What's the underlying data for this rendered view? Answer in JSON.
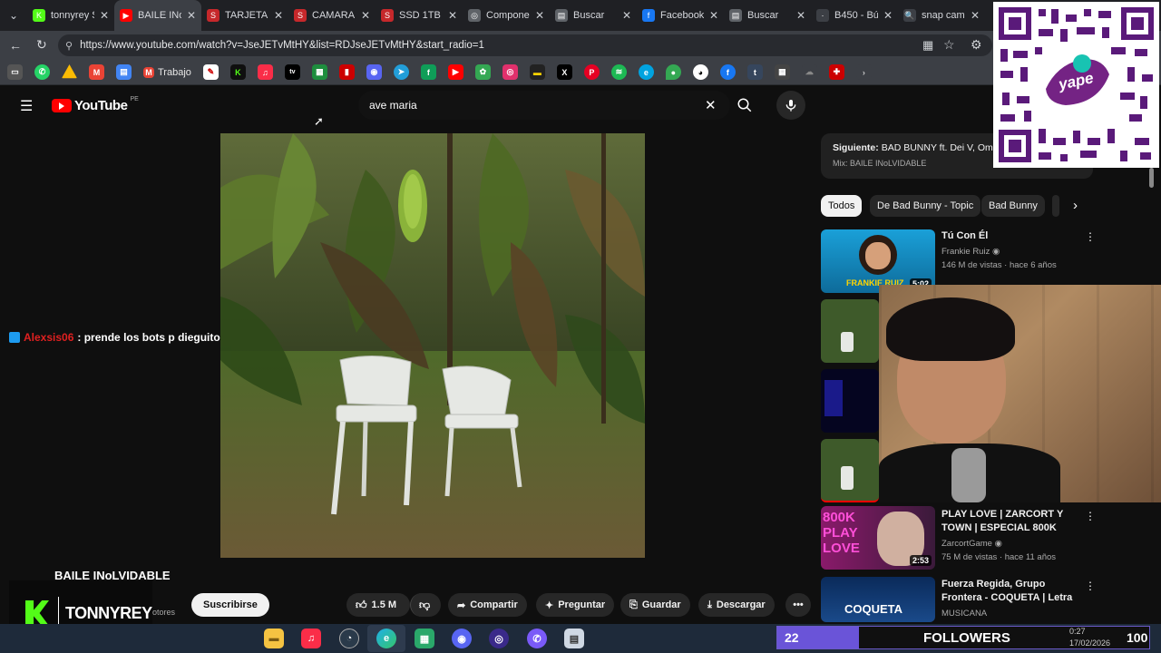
{
  "tabs": [
    {
      "label": "tonnyrey St",
      "color": "#53fc18",
      "glyph": "K",
      "active": false
    },
    {
      "label": "BAILE INoLVI",
      "color": "#ff0000",
      "glyph": "▶",
      "active": true
    },
    {
      "label": "TARJETA DE",
      "color": "#c6282b",
      "glyph": "S",
      "active": false
    },
    {
      "label": "CAMARA W",
      "color": "#c6282b",
      "glyph": "S",
      "active": false
    },
    {
      "label": "SSD 1TB KI",
      "color": "#c6282b",
      "glyph": "S",
      "active": false
    },
    {
      "label": "Componen",
      "color": "#5f6368",
      "glyph": "◎",
      "active": false
    },
    {
      "label": "Buscar",
      "color": "#5f6368",
      "glyph": "▤",
      "active": false
    },
    {
      "label": "Facebook",
      "color": "#1877f2",
      "glyph": "f",
      "active": false
    },
    {
      "label": "Buscar",
      "color": "#5f6368",
      "glyph": "▤",
      "active": false
    },
    {
      "label": "B450 - Bús",
      "color": "#3c3f45",
      "glyph": "·",
      "active": false
    },
    {
      "label": "snap came",
      "color": "#3c3f45",
      "glyph": "🔍",
      "active": false
    }
  ],
  "address": {
    "url": "https://www.youtube.com/watch?v=JseJETvMtHY&list=RDJseJETvMtHY&start_radio=1"
  },
  "bookmarks": {
    "trabajo_label": "Trabajo"
  },
  "youtube": {
    "logo_text": "YouTube",
    "region": "PE",
    "search_value": "ave maria"
  },
  "chat": {
    "user": "Alexsis06",
    "message": ": prende los bots p dieguito"
  },
  "video": {
    "title": "BAILE INoLVIDABLE",
    "channel_partial": "otores",
    "subscribe_label": "Suscribirse",
    "likes": "1.5 M",
    "share_label": "Compartir",
    "ask_label": "Preguntar",
    "save_label": "Guardar",
    "download_label": "Descargar"
  },
  "up_next": {
    "label": "Siguiente:",
    "title": "BAD BUNNY ft. Dei V, Omar",
    "mix": "Mix: BAILE INoLVIDABLE"
  },
  "chips": [
    "Todos",
    "De Bad Bunny - Topic",
    "Bad Bunny"
  ],
  "recommendations": [
    {
      "title": "Tú Con Él",
      "channel": "Frankie Ruiz",
      "meta": "146 M de vistas · hace 6 años",
      "duration": "5:02",
      "thumb_text": "FRANKIE RUIZ"
    },
    {
      "title": "PLAY LOVE | ZARCORT Y TOWN | ESPECIAL 800K",
      "channel": "ZarcortGame",
      "meta": "75 M de vistas · hace 11 años",
      "duration": "2:53",
      "thumb_text": "800K PLAY LOVE"
    },
    {
      "title": "Fuerza Regida, Grupo Frontera - COQUETA | Letra",
      "channel": "MUSICANA",
      "meta": "",
      "duration": "",
      "thumb_text": "COQUETA"
    }
  ],
  "stream": {
    "brand": "TONNYREY",
    "followers_count": "22",
    "followers_label": "FOLLOWERS",
    "followers_right": "100",
    "clock_time": "0:27",
    "clock_date": "17/02/2026"
  },
  "qr": {
    "brand": "yape"
  }
}
